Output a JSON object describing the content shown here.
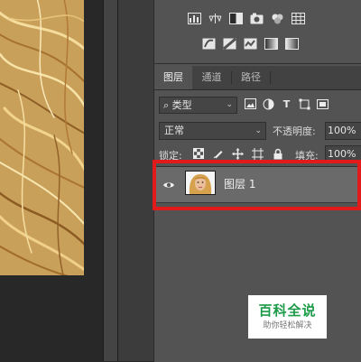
{
  "canvas": {
    "image_label": "hair-photo"
  },
  "tabs": [
    {
      "label": "图层",
      "active": true
    },
    {
      "label": "通道",
      "active": false
    },
    {
      "label": "路径",
      "active": false
    }
  ],
  "filter": {
    "search_icon": "⌕",
    "kind_label": "类型"
  },
  "blend": {
    "mode": "正常",
    "opacity_label": "不透明度:",
    "opacity_value": "100%"
  },
  "lock": {
    "label": "锁定:",
    "fill_label": "填充:",
    "fill_value": "100%"
  },
  "layers": [
    {
      "name": "图层 1",
      "visible": true,
      "selected": true
    }
  ],
  "watermark": {
    "title": "百科全说",
    "subtitle": "助你轻松解决"
  },
  "colors": {
    "highlight": "#e31a1a",
    "watermark_green": "#1c9b48",
    "panel_bg": "#535353"
  }
}
